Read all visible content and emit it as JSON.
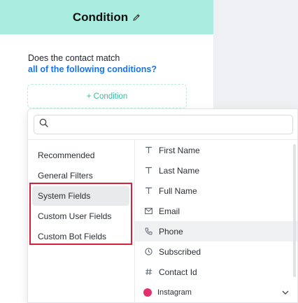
{
  "node": {
    "title": "Condition",
    "question_line1": "Does the contact match",
    "question_line2": "all of the following conditions?",
    "add_condition_label": "+ Condition"
  },
  "dropdown": {
    "search_placeholder": "",
    "categories": [
      {
        "label": "Recommended"
      },
      {
        "label": "General Filters"
      },
      {
        "label": "System Fields"
      },
      {
        "label": "Custom User Fields"
      },
      {
        "label": "Custom Bot Fields"
      }
    ],
    "fields": [
      {
        "label": "First Name",
        "icon": "text-icon"
      },
      {
        "label": "Last Name",
        "icon": "text-icon"
      },
      {
        "label": "Full Name",
        "icon": "text-icon"
      },
      {
        "label": "Email",
        "icon": "envelope-icon"
      },
      {
        "label": "Phone",
        "icon": "phone-icon"
      },
      {
        "label": "Subscribed",
        "icon": "clock-icon"
      },
      {
        "label": "Contact Id",
        "icon": "hash-icon"
      },
      {
        "label": "Instagram",
        "icon": "instagram-icon"
      }
    ]
  },
  "colors": {
    "header_bg": "#a8ede0",
    "link_blue": "#1a73e8",
    "accent_teal": "#2fbfa0",
    "highlight_red": "#d61f3a"
  }
}
